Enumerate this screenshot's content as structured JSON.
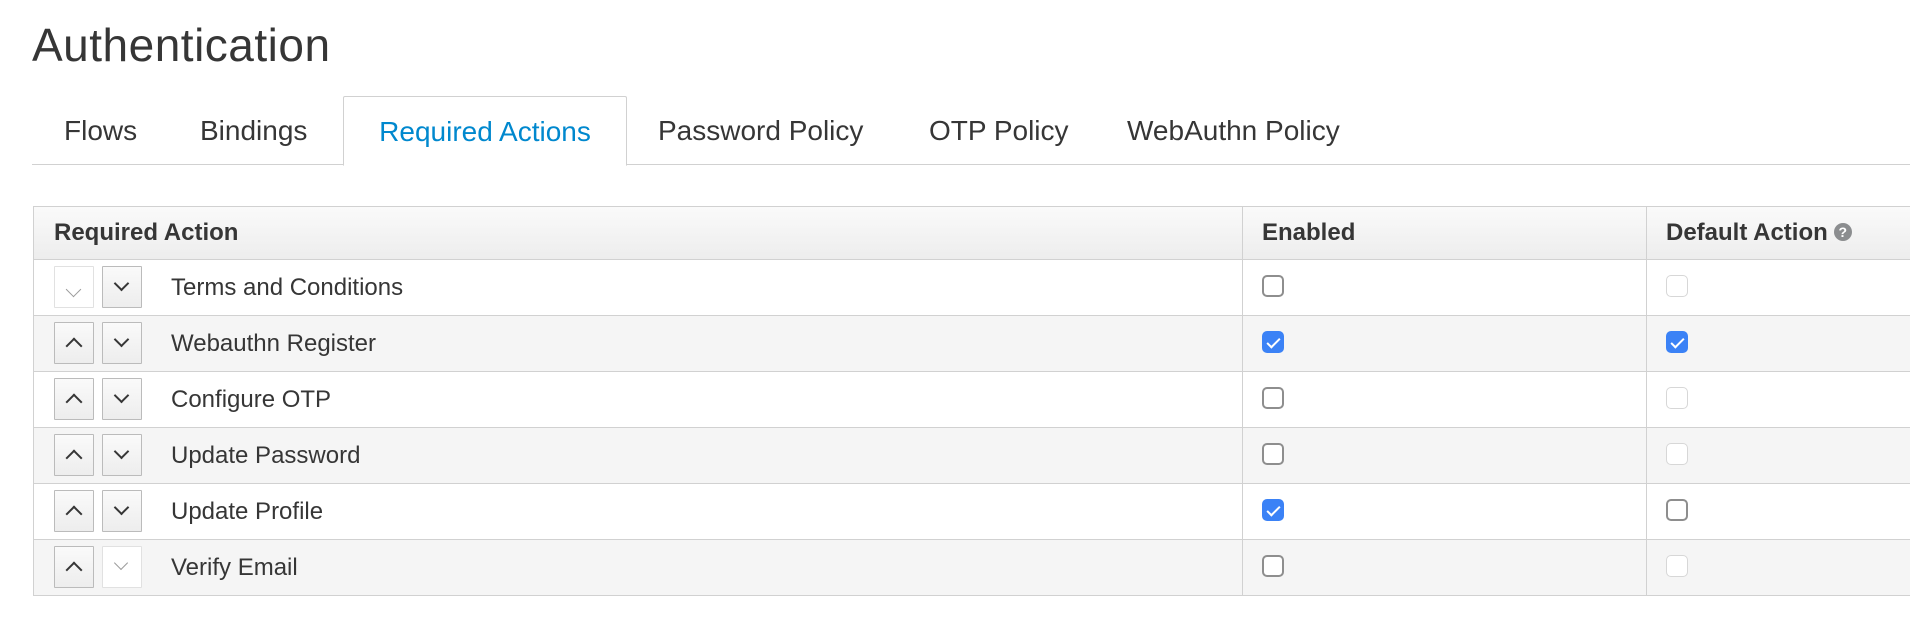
{
  "page": {
    "title": "Authentication"
  },
  "tabs": [
    {
      "label": "Flows",
      "active": false
    },
    {
      "label": "Bindings",
      "active": false
    },
    {
      "label": "Required Actions",
      "active": true
    },
    {
      "label": "Password Policy",
      "active": false
    },
    {
      "label": "OTP Policy",
      "active": false
    },
    {
      "label": "WebAuthn Policy",
      "active": false
    }
  ],
  "table": {
    "headers": {
      "action": "Required Action",
      "enabled": "Enabled",
      "default": "Default Action",
      "help_icon": "?"
    },
    "rows": [
      {
        "name": "Terms and Conditions",
        "enabled": false,
        "default_action": false,
        "default_disabled": true,
        "up_disabled": true,
        "down_disabled": false
      },
      {
        "name": "Webauthn Register",
        "enabled": true,
        "default_action": true,
        "default_disabled": false,
        "up_disabled": false,
        "down_disabled": false
      },
      {
        "name": "Configure OTP",
        "enabled": false,
        "default_action": false,
        "default_disabled": true,
        "up_disabled": false,
        "down_disabled": false
      },
      {
        "name": "Update Password",
        "enabled": false,
        "default_action": false,
        "default_disabled": true,
        "up_disabled": false,
        "down_disabled": false
      },
      {
        "name": "Update Profile",
        "enabled": true,
        "default_action": false,
        "default_disabled": false,
        "up_disabled": false,
        "down_disabled": false
      },
      {
        "name": "Verify Email",
        "enabled": false,
        "default_action": false,
        "default_disabled": true,
        "up_disabled": false,
        "down_disabled": true
      }
    ]
  },
  "colors": {
    "accent": "#0088ce",
    "checkbox": "#3b82f6"
  }
}
